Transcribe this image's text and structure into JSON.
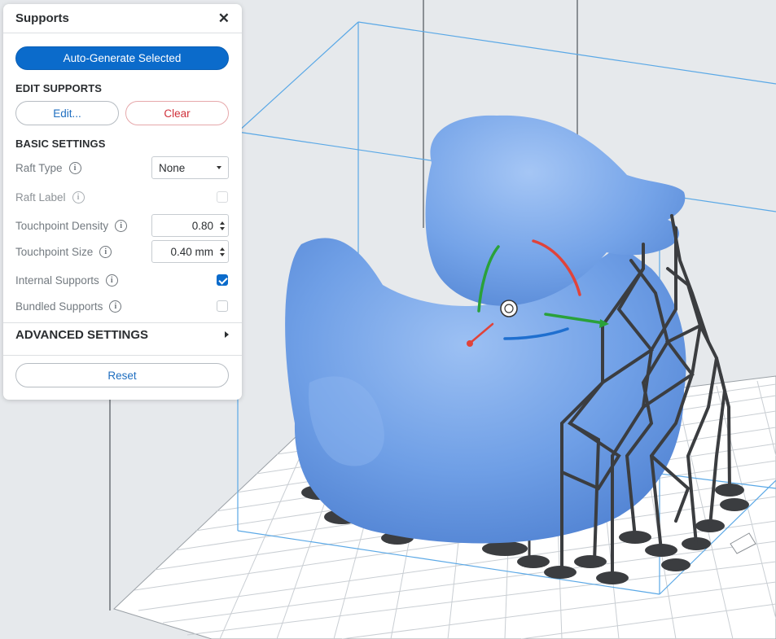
{
  "panel": {
    "title": "Supports",
    "close_icon": "close-icon",
    "auto_generate_label": "Auto-Generate Selected",
    "edit_section_title": "EDIT SUPPORTS",
    "edit_label": "Edit...",
    "clear_label": "Clear",
    "basic_section_title": "BASIC SETTINGS",
    "settings": {
      "raft_type": {
        "label": "Raft Type",
        "value": "None"
      },
      "raft_label": {
        "label": "Raft Label",
        "checked": false
      },
      "touchpoint_density": {
        "label": "Touchpoint Density",
        "value": "0.80"
      },
      "touchpoint_size": {
        "label": "Touchpoint Size",
        "value": "0.40 mm"
      },
      "internal_supports": {
        "label": "Internal Supports",
        "checked": true
      },
      "bundled_supports": {
        "label": "Bundled Supports",
        "checked": false
      }
    },
    "advanced_section_title": "ADVANCED SETTINGS",
    "reset_label": "Reset"
  },
  "viewport": {
    "model": "duck",
    "colors": {
      "model": "#6f9fe6",
      "supports": "#3b3d40",
      "build_box": "#5aa8e6",
      "accent": "#0b6bcb",
      "rotate_x": "#e0433a",
      "rotate_y": "#2aa13a",
      "rotate_z": "#1f6fcf"
    }
  }
}
